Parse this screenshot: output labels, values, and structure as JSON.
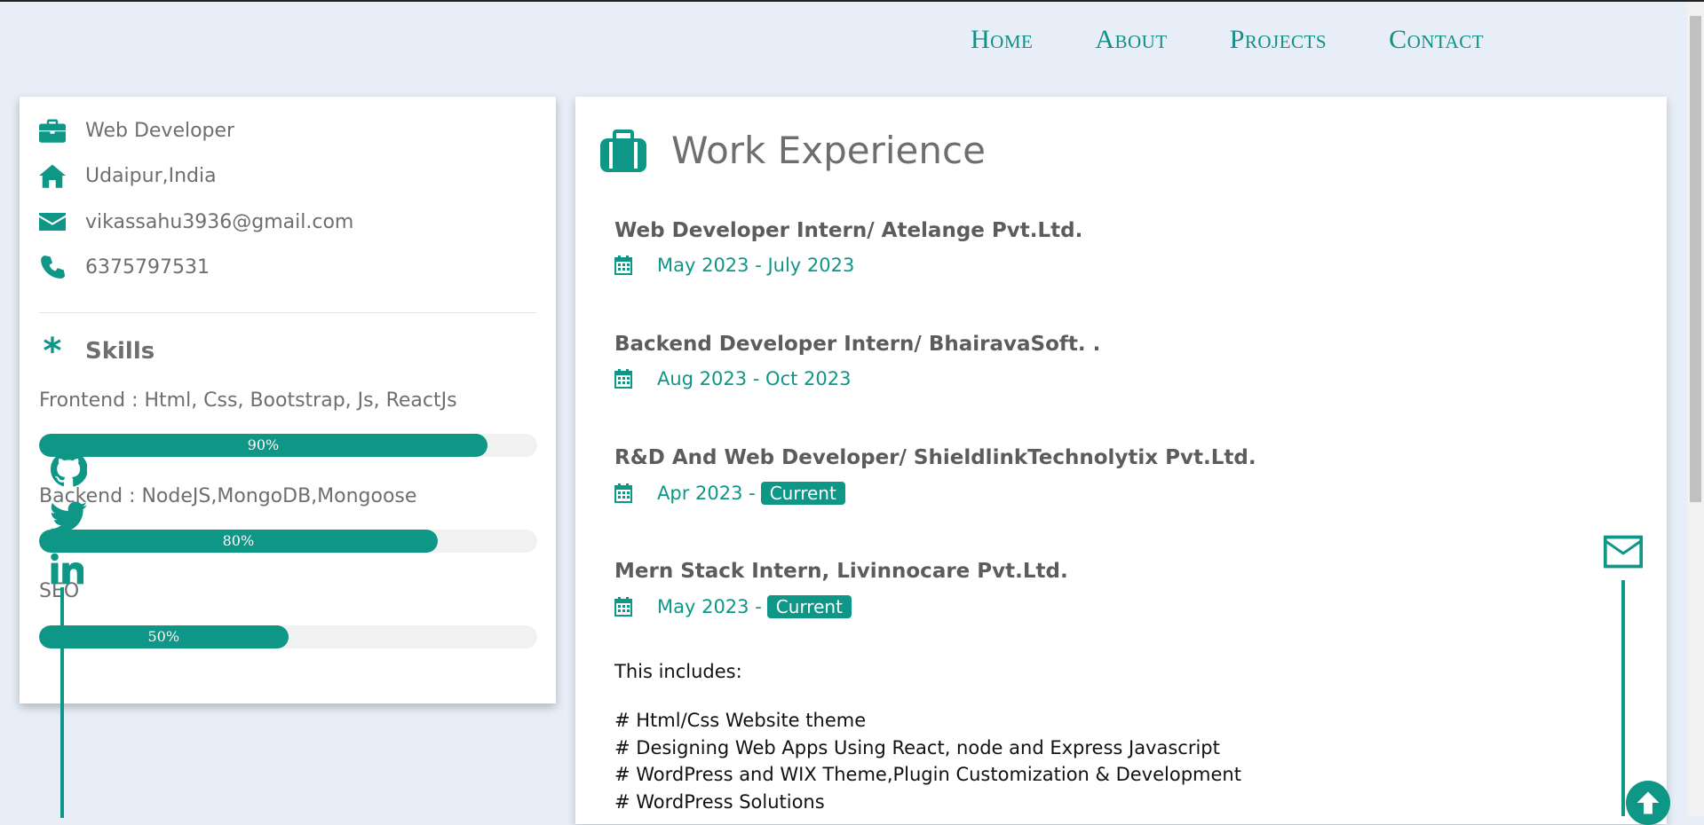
{
  "nav": {
    "items": [
      "Home",
      "About",
      "Projects",
      "Contact"
    ]
  },
  "profile": {
    "role": "Web Developer",
    "location": "Udaipur,India",
    "email": "vikassahu3936@gmail.com",
    "phone": "6375797531"
  },
  "skills": {
    "title": "Skills",
    "items": [
      {
        "label": "Frontend : Html, Css, Bootstrap, Js, ReactJs",
        "percent_text": "90%",
        "level": 0.9
      },
      {
        "label": "Backend : NodeJS,MongoDB,Mongoose",
        "percent_text": "80%",
        "level": 0.8
      },
      {
        "label": "SEO",
        "percent_text": "50%",
        "level": 0.5
      }
    ]
  },
  "work": {
    "title": "Work Experience",
    "jobs": [
      {
        "title": "Web Developer Intern/ Atelange Pvt.Ltd.",
        "dates": "May 2023 - July 2023",
        "badge": ""
      },
      {
        "title": "Backend Developer Intern/ BhairavaSoft. .",
        "dates": "Aug 2023 - Oct 2023",
        "badge": ""
      },
      {
        "title": "R&D And Web Developer/ ShieldlinkTechnolytix Pvt.Ltd.",
        "dates": "Apr 2023 -",
        "badge": "Current"
      },
      {
        "title": "Mern Stack Intern, Livinnocare Pvt.Ltd.",
        "dates": "May 2023 -",
        "badge": "Current"
      }
    ],
    "includes_label": "This includes:",
    "includes": [
      "# Html/Css Website theme",
      "# Designing Web Apps Using React, node and Express Javascript",
      "# WordPress and WIX Theme,Plugin Customization & Development",
      "# WordPress Solutions"
    ]
  },
  "icons": {
    "accent": "#0e9686",
    "social": [
      "github-icon",
      "twitter-icon",
      "linkedin-icon"
    ]
  }
}
